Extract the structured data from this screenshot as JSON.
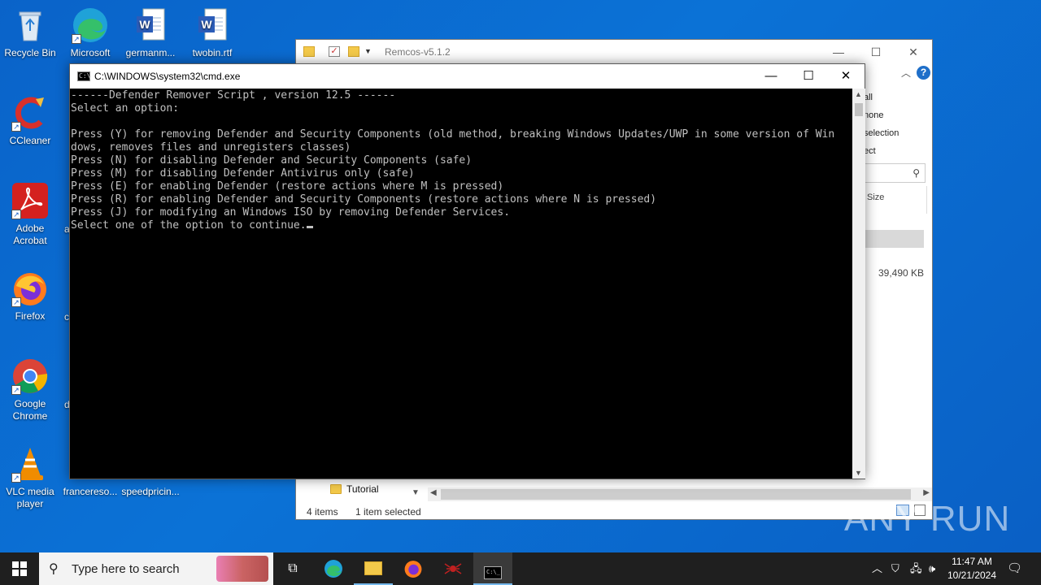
{
  "desktop": {
    "icons": [
      {
        "label": "Recycle Bin",
        "icon": "recycle-bin-icon"
      },
      {
        "label": "Microsoft Edge",
        "icon": "edge-icon"
      },
      {
        "label": "germanm...",
        "icon": "word-doc-icon"
      },
      {
        "label": "twobin.rtf",
        "icon": "word-doc-icon"
      },
      {
        "label": "CCleaner",
        "icon": "ccleaner-icon"
      },
      {
        "label": "Adobe Acrobat",
        "icon": "acrobat-icon"
      },
      {
        "label": "Firefox",
        "icon": "firefox-icon"
      },
      {
        "label": "Google Chrome",
        "icon": "chrome-icon"
      },
      {
        "label": "VLC media player",
        "icon": "vlc-icon"
      },
      {
        "label": "francereso...",
        "icon": "file-icon"
      },
      {
        "label": "speedpricin...",
        "icon": "file-icon"
      }
    ],
    "partial_labels": [
      "a",
      "c",
      "d"
    ]
  },
  "explorer": {
    "title": "Remcos-v5.1.2",
    "ribbon_items": [
      "all",
      "none",
      "selection",
      "ect"
    ],
    "column_size": "Size",
    "file_size": "39,490 KB",
    "nav_folder": "Tutorial",
    "status_items": "4 items",
    "status_selected": "1 item selected"
  },
  "cmd": {
    "title": "C:\\WINDOWS\\system32\\cmd.exe",
    "lines": [
      "------Defender Remover Script , version 12.5 ------",
      "Select an option:",
      "",
      "Press (Y) for removing Defender and Security Components (old method, breaking Windows Updates/UWP in some version of Win",
      "dows, removes files and unregisters classes)",
      "Press (N) for disabling Defender and Security Components (safe)",
      "Press (M) for disabling Defender Antivirus only (safe)",
      "Press (E) for enabling Defender (restore actions where M is pressed)",
      "Press (R) for enabling Defender and Security Components (restore actions where N is pressed)",
      "Press (J) for modifying an Windows ISO by removing Defender Services."
    ],
    "prompt": "Select one of the option to continue."
  },
  "taskbar": {
    "search_placeholder": "Type here to search",
    "time": "11:47 AM",
    "date": "10/21/2024"
  },
  "watermark": "ANY RUN"
}
